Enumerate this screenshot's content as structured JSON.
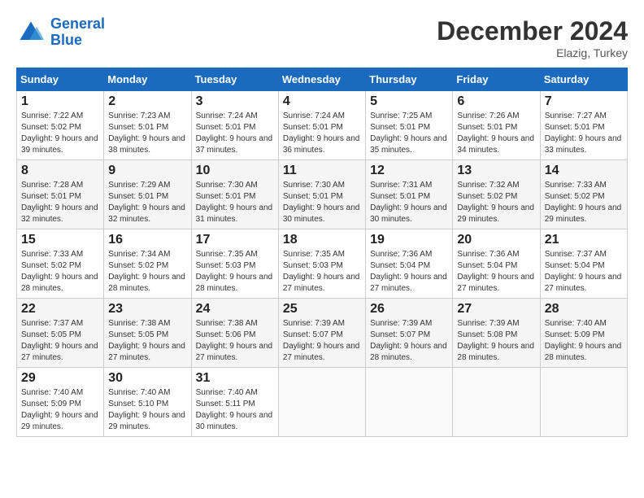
{
  "header": {
    "logo_line1": "General",
    "logo_line2": "Blue",
    "month": "December 2024",
    "location": "Elazig, Turkey"
  },
  "weekdays": [
    "Sunday",
    "Monday",
    "Tuesday",
    "Wednesday",
    "Thursday",
    "Friday",
    "Saturday"
  ],
  "weeks": [
    [
      {
        "day": "1",
        "sunrise": "7:22 AM",
        "sunset": "5:02 PM",
        "daylight": "9 hours and 39 minutes."
      },
      {
        "day": "2",
        "sunrise": "7:23 AM",
        "sunset": "5:01 PM",
        "daylight": "9 hours and 38 minutes."
      },
      {
        "day": "3",
        "sunrise": "7:24 AM",
        "sunset": "5:01 PM",
        "daylight": "9 hours and 37 minutes."
      },
      {
        "day": "4",
        "sunrise": "7:24 AM",
        "sunset": "5:01 PM",
        "daylight": "9 hours and 36 minutes."
      },
      {
        "day": "5",
        "sunrise": "7:25 AM",
        "sunset": "5:01 PM",
        "daylight": "9 hours and 35 minutes."
      },
      {
        "day": "6",
        "sunrise": "7:26 AM",
        "sunset": "5:01 PM",
        "daylight": "9 hours and 34 minutes."
      },
      {
        "day": "7",
        "sunrise": "7:27 AM",
        "sunset": "5:01 PM",
        "daylight": "9 hours and 33 minutes."
      }
    ],
    [
      {
        "day": "8",
        "sunrise": "7:28 AM",
        "sunset": "5:01 PM",
        "daylight": "9 hours and 32 minutes."
      },
      {
        "day": "9",
        "sunrise": "7:29 AM",
        "sunset": "5:01 PM",
        "daylight": "9 hours and 32 minutes."
      },
      {
        "day": "10",
        "sunrise": "7:30 AM",
        "sunset": "5:01 PM",
        "daylight": "9 hours and 31 minutes."
      },
      {
        "day": "11",
        "sunrise": "7:30 AM",
        "sunset": "5:01 PM",
        "daylight": "9 hours and 30 minutes."
      },
      {
        "day": "12",
        "sunrise": "7:31 AM",
        "sunset": "5:01 PM",
        "daylight": "9 hours and 30 minutes."
      },
      {
        "day": "13",
        "sunrise": "7:32 AM",
        "sunset": "5:02 PM",
        "daylight": "9 hours and 29 minutes."
      },
      {
        "day": "14",
        "sunrise": "7:33 AM",
        "sunset": "5:02 PM",
        "daylight": "9 hours and 29 minutes."
      }
    ],
    [
      {
        "day": "15",
        "sunrise": "7:33 AM",
        "sunset": "5:02 PM",
        "daylight": "9 hours and 28 minutes."
      },
      {
        "day": "16",
        "sunrise": "7:34 AM",
        "sunset": "5:02 PM",
        "daylight": "9 hours and 28 minutes."
      },
      {
        "day": "17",
        "sunrise": "7:35 AM",
        "sunset": "5:03 PM",
        "daylight": "9 hours and 28 minutes."
      },
      {
        "day": "18",
        "sunrise": "7:35 AM",
        "sunset": "5:03 PM",
        "daylight": "9 hours and 27 minutes."
      },
      {
        "day": "19",
        "sunrise": "7:36 AM",
        "sunset": "5:04 PM",
        "daylight": "9 hours and 27 minutes."
      },
      {
        "day": "20",
        "sunrise": "7:36 AM",
        "sunset": "5:04 PM",
        "daylight": "9 hours and 27 minutes."
      },
      {
        "day": "21",
        "sunrise": "7:37 AM",
        "sunset": "5:04 PM",
        "daylight": "9 hours and 27 minutes."
      }
    ],
    [
      {
        "day": "22",
        "sunrise": "7:37 AM",
        "sunset": "5:05 PM",
        "daylight": "9 hours and 27 minutes."
      },
      {
        "day": "23",
        "sunrise": "7:38 AM",
        "sunset": "5:05 PM",
        "daylight": "9 hours and 27 minutes."
      },
      {
        "day": "24",
        "sunrise": "7:38 AM",
        "sunset": "5:06 PM",
        "daylight": "9 hours and 27 minutes."
      },
      {
        "day": "25",
        "sunrise": "7:39 AM",
        "sunset": "5:07 PM",
        "daylight": "9 hours and 27 minutes."
      },
      {
        "day": "26",
        "sunrise": "7:39 AM",
        "sunset": "5:07 PM",
        "daylight": "9 hours and 28 minutes."
      },
      {
        "day": "27",
        "sunrise": "7:39 AM",
        "sunset": "5:08 PM",
        "daylight": "9 hours and 28 minutes."
      },
      {
        "day": "28",
        "sunrise": "7:40 AM",
        "sunset": "5:09 PM",
        "daylight": "9 hours and 28 minutes."
      }
    ],
    [
      {
        "day": "29",
        "sunrise": "7:40 AM",
        "sunset": "5:09 PM",
        "daylight": "9 hours and 29 minutes."
      },
      {
        "day": "30",
        "sunrise": "7:40 AM",
        "sunset": "5:10 PM",
        "daylight": "9 hours and 29 minutes."
      },
      {
        "day": "31",
        "sunrise": "7:40 AM",
        "sunset": "5:11 PM",
        "daylight": "9 hours and 30 minutes."
      },
      null,
      null,
      null,
      null
    ]
  ]
}
